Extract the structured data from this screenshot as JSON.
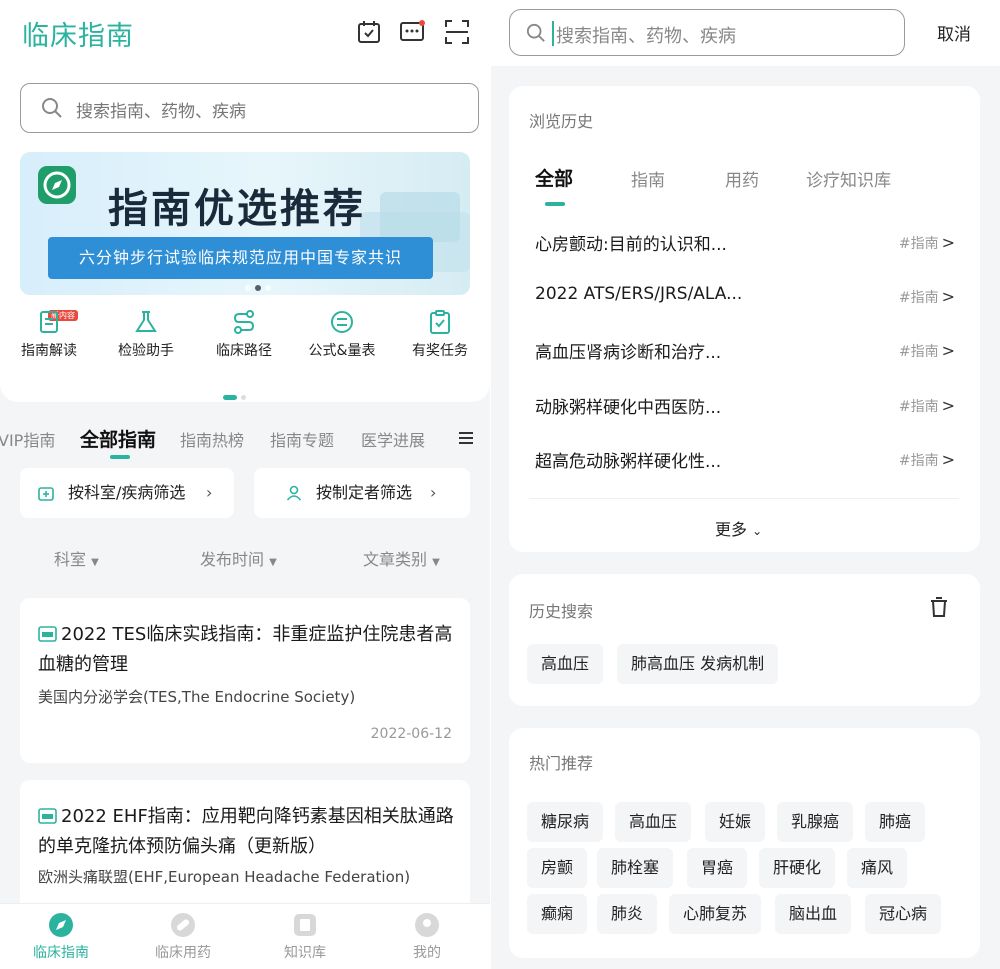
{
  "left": {
    "logo": "临床指南",
    "search_placeholder": "搜索指南、药物、疾病",
    "banner": {
      "title": "指南优选推荐",
      "subtitle": "六分钟步行试验临床规范应用中国专家共识"
    },
    "quick_badge": "新内容",
    "quick_items": [
      {
        "label": "指南解读",
        "icon": "document-icon"
      },
      {
        "label": "检验助手",
        "icon": "flask-icon"
      },
      {
        "label": "临床路径",
        "icon": "route-icon"
      },
      {
        "label": "公式&量表",
        "icon": "formula-icon"
      },
      {
        "label": "有奖任务",
        "icon": "clipboard-check-icon"
      }
    ],
    "tabs": [
      "VIP指南",
      "全部指南",
      "指南热榜",
      "指南专题",
      "医学进展"
    ],
    "active_tab": "全部指南",
    "filters": [
      {
        "label": "按科室/疾病筛选",
        "icon": "medical-kit-icon"
      },
      {
        "label": "按制定者筛选",
        "icon": "person-icon"
      }
    ],
    "sorts": [
      "科室",
      "发布时间",
      "文章类别"
    ],
    "articles": [
      {
        "title": "2022 TES临床实践指南：非重症监护住院患者高血糖的管理",
        "source": "美国内分泌学会(TES,The Endocrine Society)",
        "date": "2022-06-12"
      },
      {
        "title": "2022 EHF指南：应用靶向降钙素基因相关肽通路的单克隆抗体预防偏头痛（更新版）",
        "source": "欧洲头痛联盟(EHF,European Headache Federation)",
        "date": ""
      }
    ],
    "bottom_nav": [
      {
        "label": "临床指南",
        "active": true
      },
      {
        "label": "临床用药",
        "active": false
      },
      {
        "label": "知识库",
        "active": false
      },
      {
        "label": "我的",
        "active": false
      }
    ]
  },
  "right": {
    "search_placeholder": "搜索指南、药物、疾病",
    "cancel_label": "取消",
    "browse_history": {
      "title": "浏览历史",
      "tabs": [
        "全部",
        "指南",
        "用药",
        "诊疗知识库"
      ],
      "active_tab": "全部",
      "items": [
        {
          "title": "心房颤动:目前的认识和...",
          "tag": "#指南",
          "arrow": ">"
        },
        {
          "title": "2022 ATS/ERS/JRS/ALA...",
          "tag": "#指南",
          "arrow": ">"
        },
        {
          "title": "高血压肾病诊断和治疗...",
          "tag": "#指南",
          "arrow": ">"
        },
        {
          "title": "动脉粥样硬化中西医防...",
          "tag": "#指南",
          "arrow": ">"
        },
        {
          "title": "超高危动脉粥样硬化性...",
          "tag": "#指南",
          "arrow": ">"
        }
      ],
      "more_label": "更多"
    },
    "search_history": {
      "title": "历史搜索",
      "chips": [
        "高血压",
        "肺高血压 发病机制"
      ]
    },
    "hot": {
      "title": "热门推荐",
      "rows": [
        [
          "糖尿病",
          "高血压",
          "妊娠",
          "乳腺癌",
          "肺癌"
        ],
        [
          "房颤",
          "肺栓塞",
          "胃癌",
          "肝硬化",
          "痛风"
        ],
        [
          "癫痫",
          "肺炎",
          "心肺复苏",
          "脑出血",
          "冠心病"
        ]
      ]
    }
  },
  "colors": {
    "accent": "#2bb3a0",
    "banner_strip": "#2f8fd6",
    "badge": "#e94a3f"
  }
}
